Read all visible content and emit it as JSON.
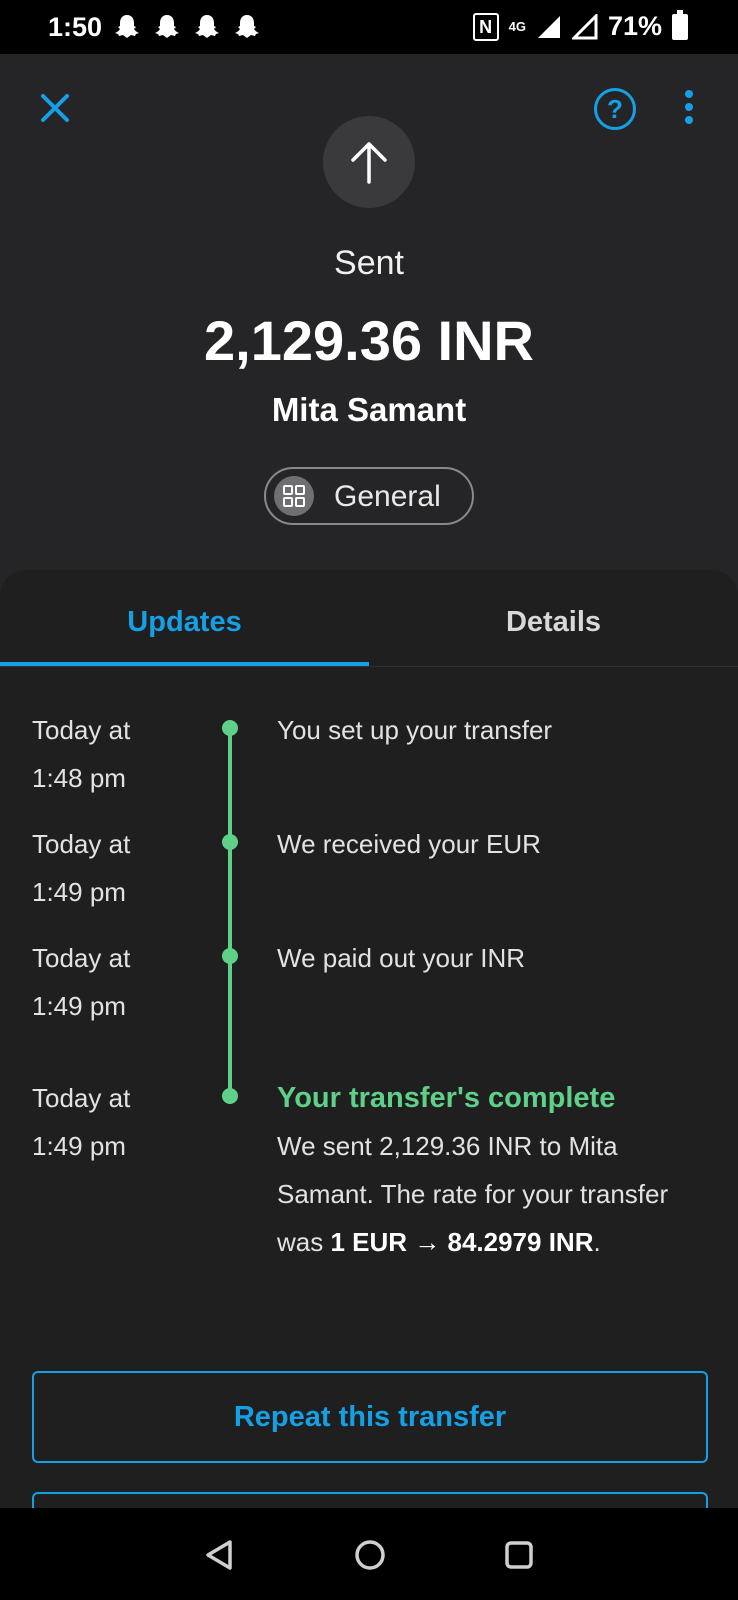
{
  "status_bar": {
    "time": "1:50",
    "network": "4G",
    "battery": "71%"
  },
  "header": {
    "status_label": "Sent",
    "amount": "2,129.36 INR",
    "recipient": "Mita Samant",
    "category": "General"
  },
  "tabs": [
    {
      "label": "Updates",
      "active": true
    },
    {
      "label": "Details",
      "active": false
    }
  ],
  "timeline": [
    {
      "date": "Today at",
      "time": "1:48 pm",
      "title": "You set up your transfer"
    },
    {
      "date": "Today at",
      "time": "1:49 pm",
      "title": "We received your EUR"
    },
    {
      "date": "Today at",
      "time": "1:49 pm",
      "title": "We paid out your INR"
    },
    {
      "date": "Today at",
      "time": "1:49 pm",
      "title": "Your transfer's complete",
      "desc_prefix": "We sent 2,129.36 INR to Mita Samant. The rate for your transfer was ",
      "desc_rate": "1 EUR → 84.2979 INR",
      "desc_suffix": "."
    }
  ],
  "actions": {
    "repeat_label": "Repeat this transfer"
  },
  "colors": {
    "accent": "#15a0e6",
    "success": "#5fd088",
    "background": "#252527"
  }
}
